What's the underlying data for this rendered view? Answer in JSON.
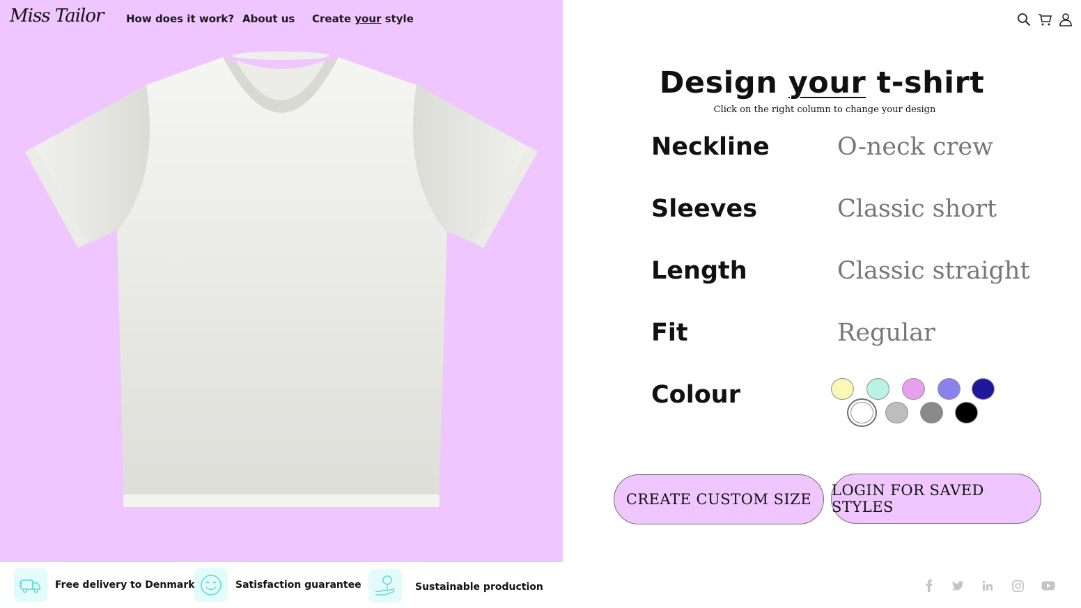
{
  "brand": {
    "logo": "Miss Tailor"
  },
  "nav": {
    "how_it_works": "How does it work?",
    "about_us": "About us",
    "create_prefix": "Create ",
    "create_emph": "your",
    "create_suffix": " style"
  },
  "header_icons": [
    "search-icon",
    "cart-icon",
    "user-icon"
  ],
  "design": {
    "title_prefix": "Design ",
    "title_emph": "your",
    "title_suffix": " t-shirt",
    "subtitle": "Click on the right column to change your design",
    "options": [
      {
        "label": "Neckline",
        "value": "O-neck crew"
      },
      {
        "label": "Sleeves",
        "value": "Classic short"
      },
      {
        "label": "Length",
        "value": "Classic straight"
      },
      {
        "label": "Fit",
        "value": "Regular"
      }
    ],
    "colour_label": "Colour",
    "colours": [
      "#fbf8b5",
      "#b9f3e3",
      "#e8a0ee",
      "#8a82ec",
      "#20189b",
      "#ffffff",
      "#bdbdbd",
      "#8a8a8a",
      "#000000"
    ],
    "selected_colour": "#ffffff",
    "accent_colour": "#efc6ff"
  },
  "buttons": {
    "custom_size": "CREATE CUSTOM SIZE",
    "login_saved": "LOGIN FOR SAVED STYLES"
  },
  "features": [
    {
      "icon": "delivery-truck-icon",
      "text": "Free delivery to Denmark"
    },
    {
      "icon": "smiley-icon",
      "text": "Satisfaction guarantee"
    },
    {
      "icon": "plant-hand-icon",
      "text": "Sustainable production"
    }
  ],
  "social_icons": [
    "facebook-icon",
    "twitter-icon",
    "linkedin-icon",
    "instagram-icon",
    "youtube-icon"
  ]
}
